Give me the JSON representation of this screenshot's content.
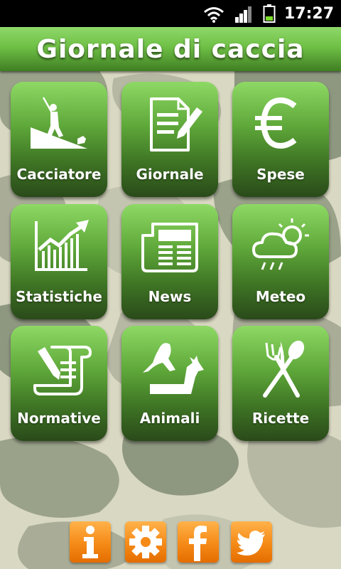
{
  "status_bar": {
    "time": "17:27"
  },
  "header": {
    "title": "Giornale di caccia"
  },
  "tiles": [
    {
      "label": "Cacciatore",
      "icon": "hunter-icon"
    },
    {
      "label": "Giornale",
      "icon": "journal-icon"
    },
    {
      "label": "Spese",
      "icon": "euro-icon"
    },
    {
      "label": "Statistiche",
      "icon": "chart-icon"
    },
    {
      "label": "News",
      "icon": "newspaper-icon"
    },
    {
      "label": "Meteo",
      "icon": "weather-icon"
    },
    {
      "label": "Normative",
      "icon": "regulations-icon"
    },
    {
      "label": "Animali",
      "icon": "animals-icon"
    },
    {
      "label": "Ricette",
      "icon": "cutlery-icon"
    }
  ],
  "bottom_bar": [
    {
      "icon": "info-icon"
    },
    {
      "icon": "settings-icon"
    },
    {
      "icon": "facebook-icon"
    },
    {
      "icon": "twitter-icon"
    }
  ],
  "colors": {
    "header_green": "#6fc046",
    "tile_green_top": "#8ed965",
    "tile_green_bottom": "#2a4a1a",
    "button_orange": "#f58a17"
  }
}
